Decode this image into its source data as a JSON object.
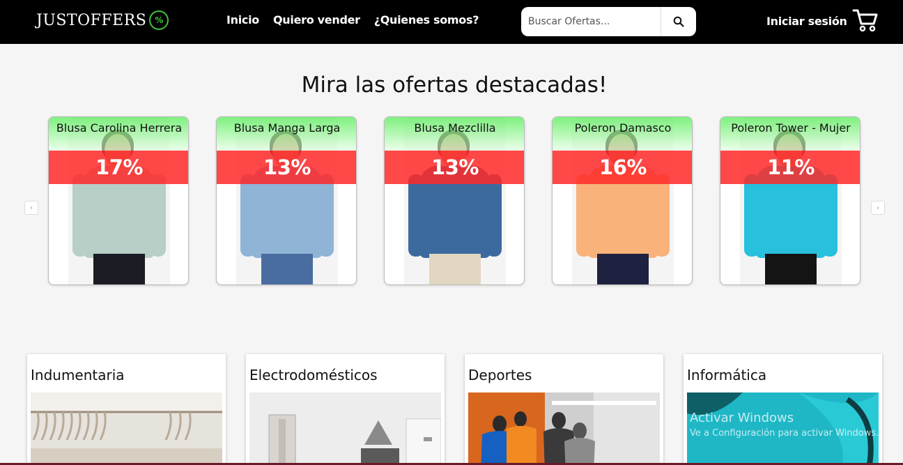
{
  "brand": {
    "name": "JUSTOFFERS",
    "badge": "%"
  },
  "nav": {
    "items": [
      "Inicio",
      "Quiero vender",
      "¿Quienes somos?"
    ]
  },
  "search": {
    "placeholder": "Buscar Ofertas..."
  },
  "account": {
    "login": "Iniciar sesión"
  },
  "featured": {
    "title": "Mira las ofertas destacadas!",
    "products": [
      {
        "name": "Blusa Carolina Herrera",
        "discount": "17%",
        "garment_color": "#b7cfc6",
        "legs_color": "#1c1c24"
      },
      {
        "name": "Blusa Manga Larga",
        "discount": "13%",
        "garment_color": "#8fb4d6",
        "legs_color": "#4a6da0"
      },
      {
        "name": "Blusa Mezclilla",
        "discount": "13%",
        "garment_color": "#3c6a9e",
        "legs_color": "#e2d6c0"
      },
      {
        "name": "Poleron Damasco",
        "discount": "16%",
        "garment_color": "#f8b27a",
        "legs_color": "#1e2240"
      },
      {
        "name": "Poleron Tower - Mujer",
        "discount": "11%",
        "garment_color": "#27c0dd",
        "legs_color": "#141414"
      }
    ]
  },
  "categories": [
    {
      "name": "Indumentaria"
    },
    {
      "name": "Electrodomésticos"
    },
    {
      "name": "Deportes"
    },
    {
      "name": "Informática"
    }
  ],
  "os_overlay": {
    "line1": "Activar Windows",
    "line2": "Ve a Configuración para activar Windows."
  },
  "colors": {
    "navbar": "#000000",
    "accent_green": "#3ec43e",
    "discount_red": "#ff2828"
  }
}
